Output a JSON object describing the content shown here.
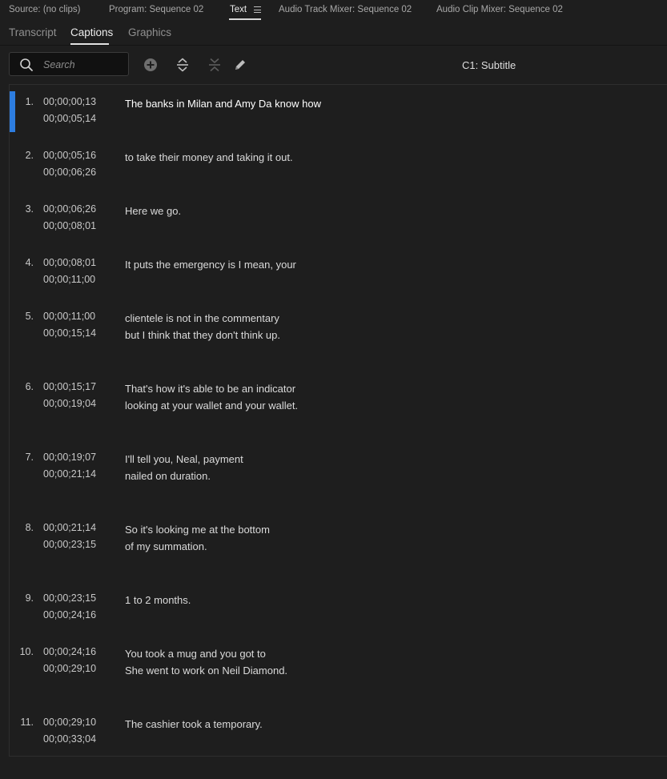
{
  "panel_tabs": [
    {
      "label": "Source: (no clips)",
      "active": false
    },
    {
      "label": "Program: Sequence 02",
      "active": false
    },
    {
      "label": "Text",
      "active": true
    },
    {
      "label": "Audio Track Mixer: Sequence 02",
      "active": false
    },
    {
      "label": "Audio Clip Mixer: Sequence 02",
      "active": false
    }
  ],
  "sub_tabs": [
    {
      "label": "Transcript",
      "active": false
    },
    {
      "label": "Captions",
      "active": true
    },
    {
      "label": "Graphics",
      "active": false
    }
  ],
  "toolbar": {
    "search_placeholder": "Search",
    "search_value": "",
    "track_label": "C1: Subtitle",
    "icons": [
      "plus-circle-icon",
      "split-icon",
      "merge-icon",
      "pencil-icon"
    ]
  },
  "colors": {
    "background": "#1e1e1e",
    "selection_accent": "#2d7de0"
  },
  "captions": [
    {
      "index": "1.",
      "in": "00;00;00;13",
      "out": "00;00;05;14",
      "text": "The banks in Milan and Amy Da know how",
      "selected": true
    },
    {
      "index": "2.",
      "in": "00;00;05;16",
      "out": "00;00;06;26",
      "text": "to take their money and taking it out."
    },
    {
      "index": "3.",
      "in": "00;00;06;26",
      "out": "00;00;08;01",
      "text": "Here we go."
    },
    {
      "index": "4.",
      "in": "00;00;08;01",
      "out": "00;00;11;00",
      "text": "It puts the emergency is I mean, your"
    },
    {
      "index": "5.",
      "in": "00;00;11;00",
      "out": "00;00;15;14",
      "text": "clientele is not in the commentary\nbut I think that they don't think up."
    },
    {
      "index": "6.",
      "in": "00;00;15;17",
      "out": "00;00;19;04",
      "text": "That's how it's able to be an indicator\nlooking at your wallet and your wallet."
    },
    {
      "index": "7.",
      "in": "00;00;19;07",
      "out": "00;00;21;14",
      "text": "I'll tell you, Neal, payment\nnailed on duration."
    },
    {
      "index": "8.",
      "in": "00;00;21;14",
      "out": "00;00;23;15",
      "text": "So it's looking me at the bottom\nof my summation."
    },
    {
      "index": "9.",
      "in": "00;00;23;15",
      "out": "00;00;24;16",
      "text": "1 to 2 months."
    },
    {
      "index": "10.",
      "in": "00;00;24;16",
      "out": "00;00;29;10",
      "text": "You took a mug and you got to\nShe went to work on Neil Diamond."
    },
    {
      "index": "11.",
      "in": "00;00;29;10",
      "out": "00;00;33;04",
      "text": "The cashier took a temporary."
    }
  ]
}
